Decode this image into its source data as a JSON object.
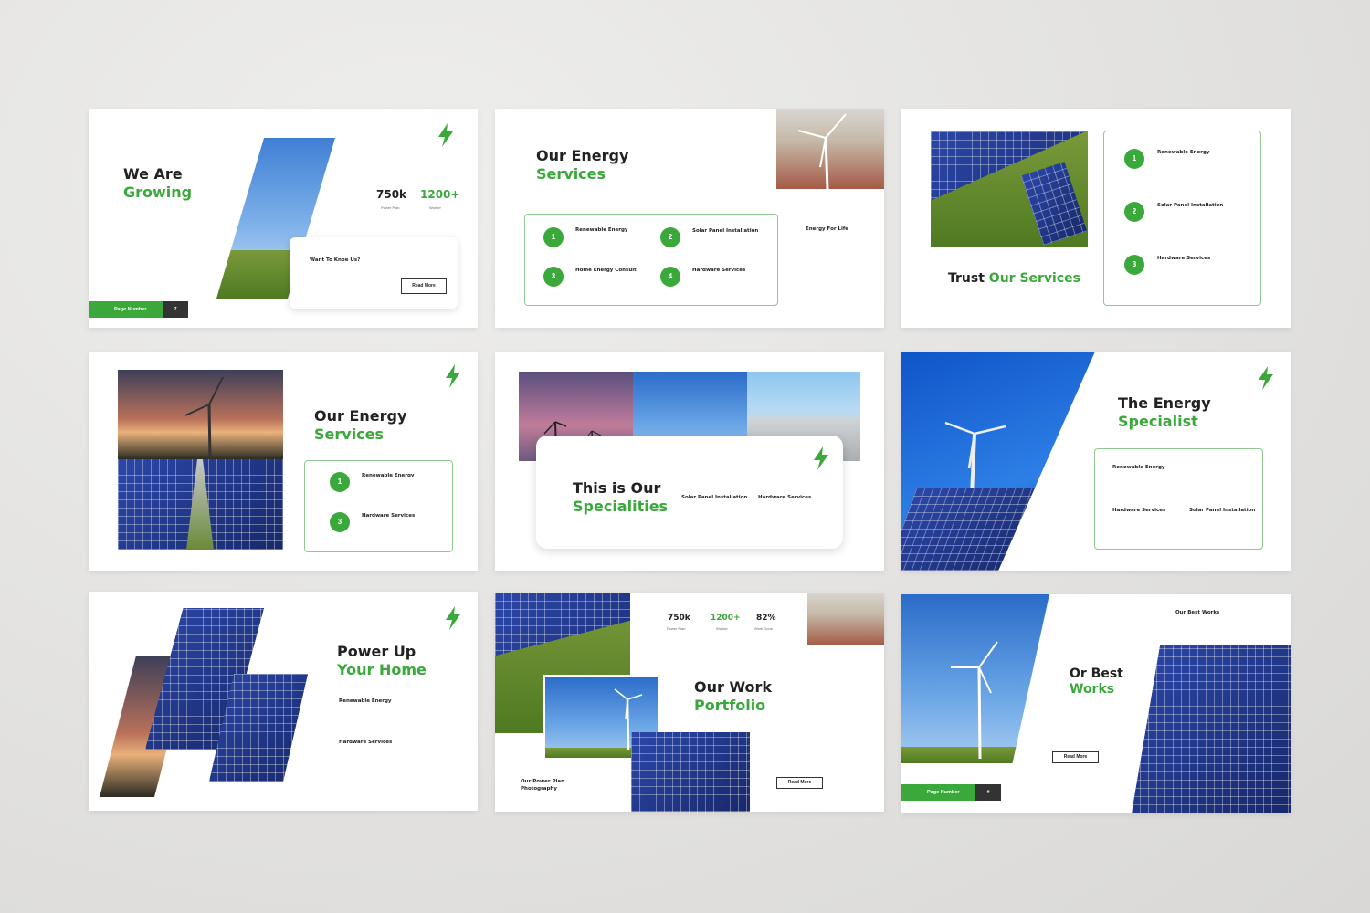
{
  "colors": {
    "accent": "#3aa83a",
    "background": "#e6e5e3",
    "dark": "#333333"
  },
  "slide1": {
    "title_line1": "We Are",
    "title_line2": "Growing",
    "stat1_value": "750k",
    "stat1_label": "Power Plan",
    "stat2_value": "1200+",
    "stat2_label": "Worker",
    "card_title": "Want To Knoe Us?",
    "button": "Read More",
    "page_label": "Page Number",
    "page_number": "7",
    "icon": "lightning-bolt-icon"
  },
  "slide2": {
    "title_line1": "Our Energy",
    "title_line2": "Services",
    "items": [
      {
        "num": "1",
        "label": "Renewable Energy"
      },
      {
        "num": "2",
        "label": "Solar Panel Installation"
      },
      {
        "num": "3",
        "label": "Home Energy Consult"
      },
      {
        "num": "4",
        "label": "Hardware Services"
      }
    ],
    "side_label": "Energy For Life"
  },
  "slide3": {
    "title_line1": "Trust",
    "title_line2": "Our Services",
    "items": [
      {
        "num": "1",
        "label": "Renewable Energy"
      },
      {
        "num": "2",
        "label": "Solar Panel Installation"
      },
      {
        "num": "3",
        "label": "Hardware Services"
      }
    ]
  },
  "slide4": {
    "title_line1": "Our Energy",
    "title_line2": "Services",
    "items": [
      {
        "num": "1",
        "label": "Renewable Energy"
      },
      {
        "num": "3",
        "label": "Hardware Services"
      }
    ]
  },
  "slide5": {
    "title_line1": "This is Our",
    "title_line2": "Specialities",
    "col1": "Solar Panel Installation",
    "col2": "Hardware Services"
  },
  "slide6": {
    "title_line1": "The Energy",
    "title_line2": "Specialist",
    "item1": "Renewable Energy",
    "item2": "Hardware Services",
    "item3": "Solar Panel Installation"
  },
  "slide7": {
    "title_line1": "Power Up",
    "title_line2": "Your Home",
    "item1": "Renewable Energy",
    "item2": "Hardware Services"
  },
  "slide8": {
    "title_line1": "Our Work",
    "title_line2": "Portfolio",
    "stat1_value": "750k",
    "stat1_label": "Power Plan",
    "stat2_value": "1200+",
    "stat2_label": "Worker",
    "stat3_value": "82%",
    "stat3_label": "Work Done",
    "caption_line1": "Our Power Plan",
    "caption_line2": "Photography",
    "button": "Read More"
  },
  "slide9": {
    "header": "Our Best Works",
    "title_line1": "Or Best",
    "title_line2": "Works",
    "button": "Read More",
    "page_label": "Page Number",
    "page_number": "#"
  }
}
